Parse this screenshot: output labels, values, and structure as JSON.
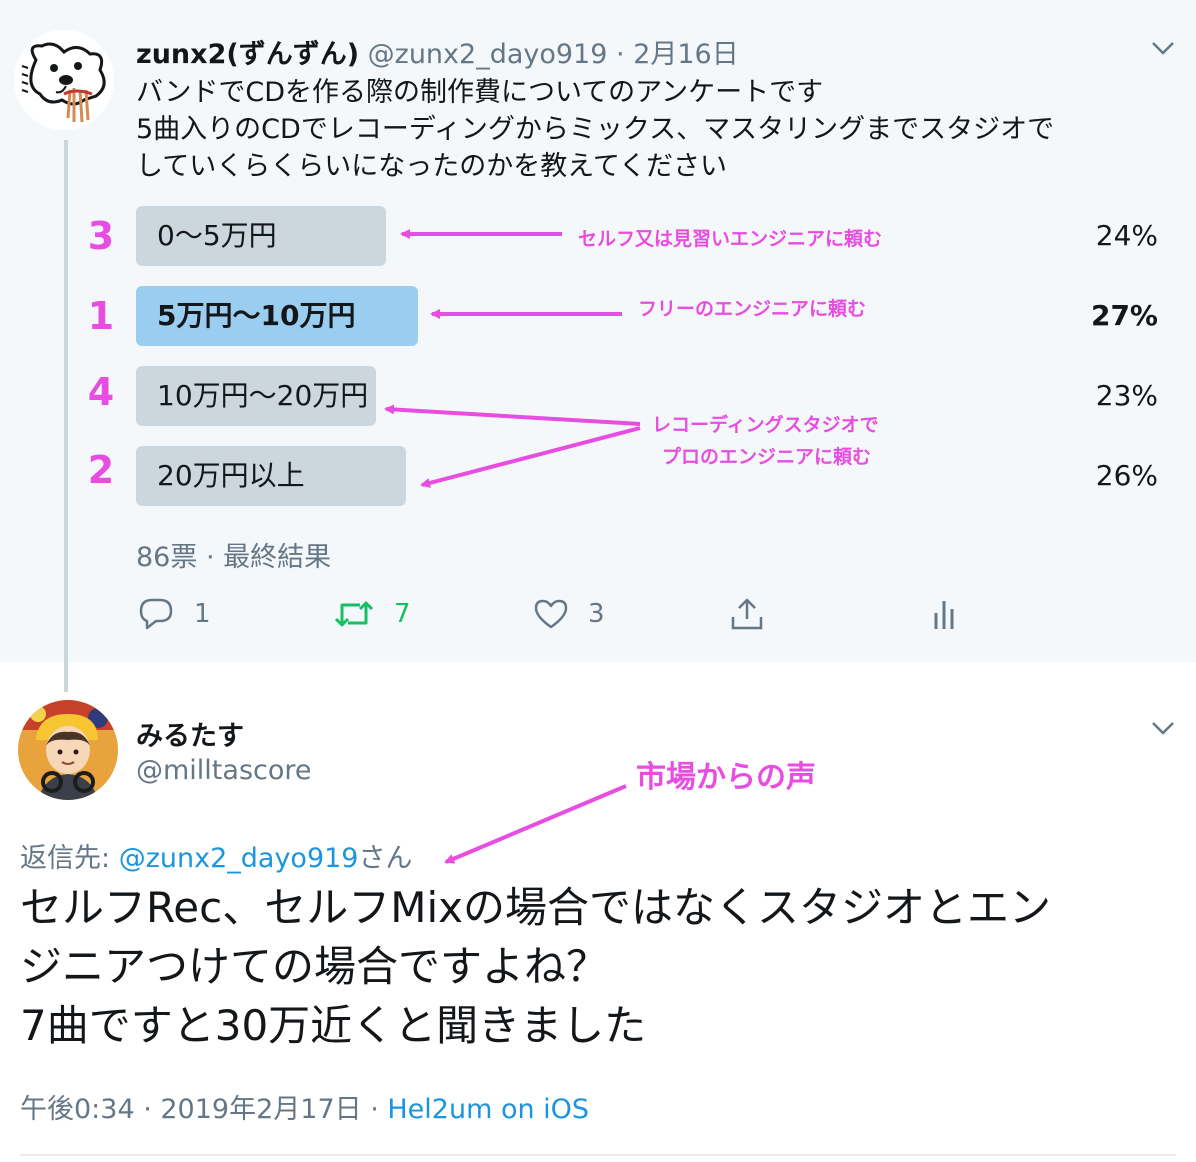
{
  "parent_tweet": {
    "author_name": "zunx2(ずんずん)",
    "handle": "@zunx2_dayo919",
    "separator": "·",
    "date": "2月16日",
    "text_lines": [
      "バンドでCDを作る際の制作費についてのアンケートです",
      "5曲入りのCDでレコーディングからミックス、マスタリングまでスタジオで",
      "していくらくらいになったのかを教えてください"
    ],
    "poll": {
      "options": [
        {
          "label": "0〜5万円",
          "percent": "24%",
          "rank": "3",
          "share": 0.24
        },
        {
          "label": "5万円〜10万円",
          "percent": "27%",
          "rank": "1",
          "share": 0.27,
          "winner": true
        },
        {
          "label": "10万円〜20万円",
          "percent": "23%",
          "rank": "4",
          "share": 0.23
        },
        {
          "label": "20万円以上",
          "percent": "26%",
          "rank": "2",
          "share": 0.26
        }
      ],
      "meta": "86票 · 最終結果"
    },
    "actions": {
      "reply_count": "1",
      "retweet_count": "7",
      "like_count": "3"
    }
  },
  "annotations": {
    "option1_note": "セルフ又は見習いエンジニアに頼む",
    "option2_note": "フリーのエンジニアに頼む",
    "option34_note_line1": "レコーディングスタジオで",
    "option34_note_line2": "プロのエンジニアに頼む",
    "reply_note": "市場からの声"
  },
  "reply_tweet": {
    "author_name": "みるたす",
    "handle": "@milltascore",
    "reply_prefix": "返信先:",
    "reply_target": "@zunx2_dayo919",
    "reply_suffix": "さん",
    "text_lines": [
      "セルフRec、セルフMixの場合ではなくスタジオとエン",
      "ジニアつけての場合ですよね？",
      "7曲ですと30万近くと聞きました"
    ],
    "time": "午後0:34 · 2019年2月17日 · ",
    "source": "Hel2um on iOS"
  },
  "colors": {
    "annotation": "#e84de2",
    "poll_bar": "#ccd6dd",
    "poll_bar_winner": "#9bcdf0",
    "link": "#1b95e0",
    "retweet": "#17bf63",
    "muted": "#657786"
  }
}
